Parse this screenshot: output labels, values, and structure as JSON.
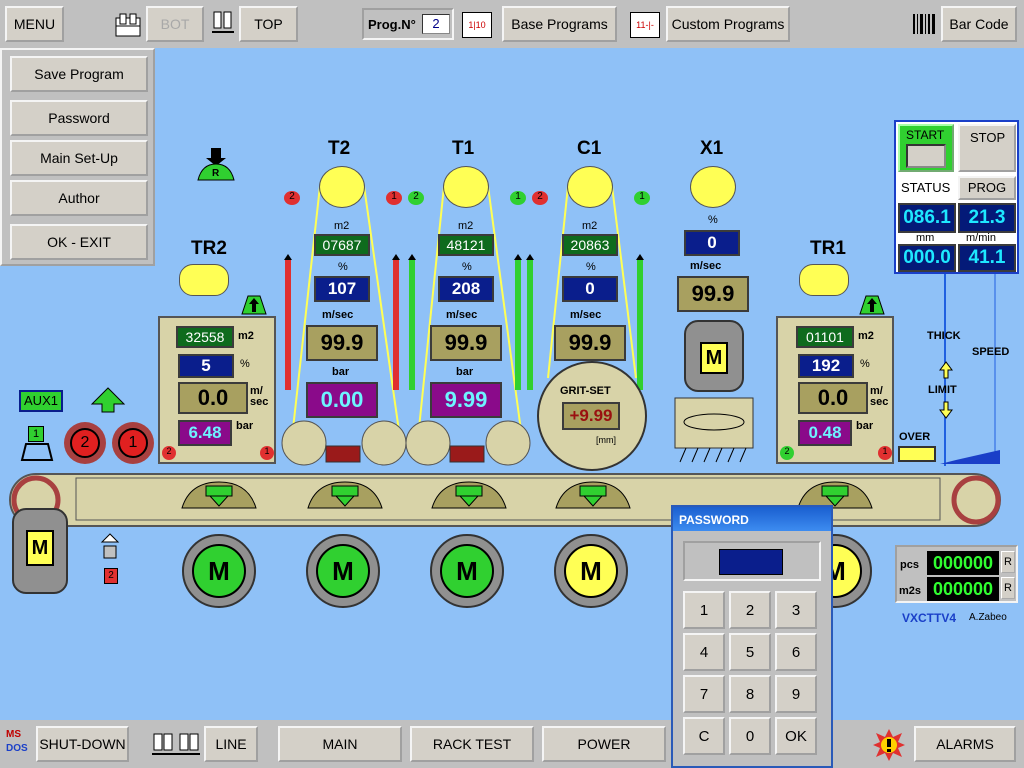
{
  "topbar": {
    "menu": "MENU",
    "bot": "BOT",
    "top": "TOP",
    "prog_label": "Prog.N°",
    "prog_value": "2",
    "base_icon_text": "1|10",
    "base_programs": "Base Programs",
    "custom_icon_text": "11-|-",
    "custom_programs": "Custom Programs",
    "bar_code": "Bar Code"
  },
  "menu_panel": {
    "items": [
      "Save Program",
      "Password",
      "Main Set-Up",
      "Author",
      "OK - EXIT"
    ]
  },
  "stations": {
    "tr2": {
      "title": "TR2",
      "m2": "32558",
      "m2_unit": "m2",
      "pct": "5",
      "pct_unit": "%",
      "speed": "0.0",
      "speed_unit": "m/\nsec",
      "bar": "6.48",
      "bar_unit": "bar",
      "left_num": "2",
      "right_num": "1"
    },
    "t2": {
      "title": "T2",
      "m2_label": "m2",
      "m2": "07687",
      "pct_label": "%",
      "pct": "107",
      "speed_label": "m/sec",
      "speed": "99.9",
      "bar_label": "bar",
      "bar": "0.00",
      "flag_l": "2",
      "flag_r": "1"
    },
    "t1": {
      "title": "T1",
      "m2_label": "m2",
      "m2": "48121",
      "pct_label": "%",
      "pct": "208",
      "speed_label": "m/sec",
      "speed": "99.9",
      "bar_label": "bar",
      "bar": "9.99",
      "flag_l": "2",
      "flag_r": "1"
    },
    "c1": {
      "title": "C1",
      "m2_label": "m2",
      "m2": "20863",
      "pct_label": "%",
      "pct": "0",
      "speed_label": "m/sec",
      "speed": "99.9",
      "flag_l": "2",
      "flag_r": "1",
      "grit_label": "GRIT-SET",
      "grit_value": "+9.99",
      "mm": "[mm]"
    },
    "x1": {
      "title": "X1",
      "pct_label": "%",
      "pct": "0",
      "speed_label": "m/sec",
      "speed": "99.9",
      "motor": "M"
    },
    "tr1": {
      "title": "TR1",
      "m2": "01101",
      "m2_unit": "m2",
      "pct": "192",
      "pct_unit": "%",
      "speed": "0.0",
      "speed_unit": "m/\nsec",
      "bar": "0.48",
      "bar_unit": "bar",
      "left_num": "2",
      "right_num": "1"
    }
  },
  "left_misc": {
    "aux1": "AUX1",
    "r_label": "R",
    "circle_2": "2",
    "circle_1": "1",
    "small_1": "1",
    "motor": "M",
    "small_2": "2"
  },
  "motors": [
    "M",
    "M",
    "M",
    "M",
    "M"
  ],
  "control": {
    "start": "START",
    "stop": "STOP",
    "status": "STATUS",
    "prog": "PROG",
    "v1": "086.1",
    "v2": "21.3",
    "mm": "mm",
    "mmin": "m/min",
    "v3": "000.0",
    "v4": "41.1",
    "thick": "THICK",
    "speed": "SPEED",
    "limit": "LIMIT",
    "over": "OVER"
  },
  "counters": {
    "pcs_label": "pcs",
    "pcs": "000000",
    "m2s_label": "m2s",
    "m2s": "000000",
    "reset": "R",
    "version": "VXCTTV4",
    "author": "A.Zabeo"
  },
  "password": {
    "title": "PASSWORD",
    "keys": [
      "1",
      "2",
      "3",
      "4",
      "5",
      "6",
      "7",
      "8",
      "9",
      "C",
      "0",
      "OK"
    ]
  },
  "bottombar": {
    "logo_top": "MS",
    "logo_bottom": "DOS",
    "shut_down": "SHUT-DOWN",
    "line": "LINE",
    "main": "MAIN",
    "rack_test": "RACK TEST",
    "power": "POWER",
    "alarms": "ALARMS"
  },
  "colors": {
    "background": "#8fc1f7",
    "yellow": "#ffff55",
    "green_box": "#0e6b1d",
    "olive": "#a8a060",
    "conveyor": "#d8d3a8"
  }
}
